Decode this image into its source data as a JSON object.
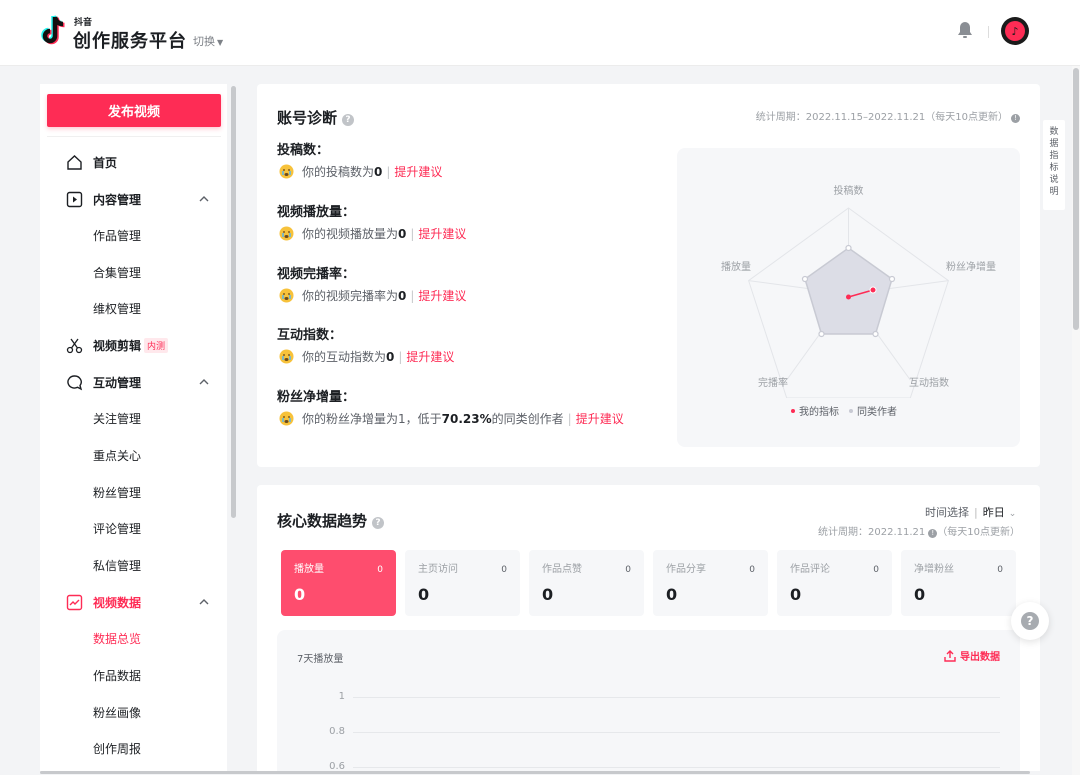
{
  "header": {
    "brand_small": "抖音",
    "brand_main": "创作服务平台",
    "switch_label": "切换"
  },
  "sidebar": {
    "publish_label": "发布视频",
    "items": [
      {
        "label": "首页",
        "icon": "home-icon"
      },
      {
        "label": "内容管理",
        "icon": "play-square-icon"
      },
      {
        "label": "作品管理"
      },
      {
        "label": "合集管理"
      },
      {
        "label": "维权管理"
      },
      {
        "label": "视频剪辑",
        "icon": "scissors-icon",
        "badge": "内测"
      },
      {
        "label": "互动管理",
        "icon": "chat-bubble-icon"
      },
      {
        "label": "关注管理"
      },
      {
        "label": "重点关心"
      },
      {
        "label": "粉丝管理"
      },
      {
        "label": "评论管理"
      },
      {
        "label": "私信管理"
      },
      {
        "label": "视频数据",
        "icon": "trend-chart-icon"
      },
      {
        "label": "数据总览"
      },
      {
        "label": "作品数据"
      },
      {
        "label": "粉丝画像"
      },
      {
        "label": "创作周报"
      }
    ]
  },
  "diagnosis": {
    "title": "账号诊断",
    "period": "统计周期：2022.11.15–2022.11.21（每天10点更新）",
    "suggest_link": "提升建议",
    "items": [
      {
        "label": "投稿数：",
        "prefix": "你的投稿数为",
        "value": "0",
        "suffix": ""
      },
      {
        "label": "视频播放量：",
        "prefix": "你的视频播放量为",
        "value": "0",
        "suffix": ""
      },
      {
        "label": "视频完播率：",
        "prefix": "你的视频完播率为",
        "value": "0",
        "suffix": ""
      },
      {
        "label": "互动指数：",
        "prefix": "你的互动指数为",
        "value": "0",
        "suffix": ""
      },
      {
        "label": "粉丝净增量：",
        "prefix": "你的粉丝净增量为1，低于",
        "value": "70.23%",
        "suffix": "的同类创作者"
      }
    ],
    "radar": {
      "axes": [
        "投稿数",
        "粉丝净增量",
        "互动指数",
        "完播率",
        "播放量"
      ],
      "legend_mine": "我的指标",
      "legend_peer": "同类作者",
      "mine_color": "#fe2c55",
      "peer_color": "#c8cad3"
    }
  },
  "trend": {
    "title": "核心数据趋势",
    "time_select_label": "时间选择",
    "time_select_value": "昨日",
    "period": "统计周期：2022.11.21",
    "period_note": "（每天10点更新）",
    "metrics": [
      {
        "name": "播放量",
        "change": "0",
        "value": "0"
      },
      {
        "name": "主页访问",
        "change": "0",
        "value": "0"
      },
      {
        "name": "作品点赞",
        "change": "0",
        "value": "0"
      },
      {
        "name": "作品分享",
        "change": "0",
        "value": "0"
      },
      {
        "name": "作品评论",
        "change": "0",
        "value": "0"
      },
      {
        "name": "净增粉丝",
        "change": "0",
        "value": "0"
      }
    ],
    "chart_title": "7天播放量",
    "export_label": "导出数据",
    "y_ticks": [
      "1",
      "0.8",
      "0.6"
    ]
  },
  "side_tab": "数据指标说明",
  "fab": "?",
  "accent_color": "#fe2c55"
}
